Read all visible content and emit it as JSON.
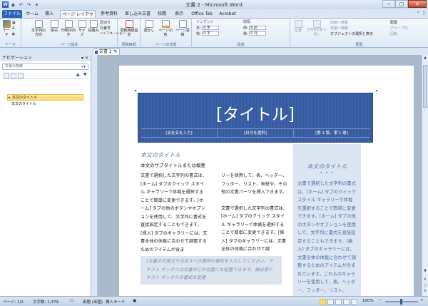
{
  "window": {
    "title": "文書 2 - Microsoft Word",
    "minimize": "─",
    "maximize": "□",
    "close": "✕"
  },
  "tabs": {
    "file": "ファイル",
    "items": [
      "ホーム",
      "挿入",
      "ページ レイアウト",
      "参考資料",
      "差し込み文書",
      "校閲",
      "表示",
      "Office Tab",
      "Acrobat"
    ],
    "active": "ページ レイアウト"
  },
  "ribbon": {
    "theme_group": {
      "label": "テーマ",
      "theme": "テーマ",
      "colors": "配色",
      "fonts": "フォント",
      "effects": "効果"
    },
    "page_setup": {
      "label": "ページ設定",
      "text_direction": "文字列の方向",
      "margins": "余白",
      "orientation": "印刷の向き",
      "size": "サイズ",
      "columns": "段組み",
      "breaks": "区切り",
      "line_numbers": "行番号",
      "hyphenation": "ハイフネーション"
    },
    "manuscript": {
      "label": "原稿用紙",
      "button": "原稿用紙設定"
    },
    "page_background": {
      "label": "ページの背景",
      "watermark": "透かし",
      "page_color": "ページの色",
      "page_borders": "ページ罫線"
    },
    "paragraph": {
      "label": "段落",
      "indent": "インデント",
      "spacing": "間隔",
      "left_label": "左:",
      "left_value": "0 字",
      "right_label": "右:",
      "right_value": "0 字",
      "before_label": "前:",
      "before_value": "6 pt",
      "after_label": "後:",
      "after_value": "0 行"
    },
    "arrange": {
      "label": "配置",
      "position": "位置",
      "wrap": "文字列の折り返し",
      "bring_forward": "前面へ移動",
      "send_backward": "背面へ移動",
      "selection_pane": "オブジェクトの選択と表示",
      "align": "配置",
      "group": "グループ化",
      "rotate": "回転"
    }
  },
  "doc_tab": {
    "label": "文書 2 *",
    "close": "×"
  },
  "nav": {
    "title": "ナビゲーション",
    "search_placeholder": "文書の検索",
    "items": [
      "本文のタイトル",
      "本文のタイトル"
    ]
  },
  "page": {
    "banner_title": "[タイトル]",
    "banner_fields": [
      "[会社名を入力]",
      "[日付を選択]",
      "[第 1 版、第 1 巻]"
    ],
    "main_title": "本文のタイトル",
    "main_sub": "本文のサブタイトルまたは概要",
    "col1": "文書で選択した文字列の書式は、[ホーム] タブのクイック スタイル ギャラリーで体裁を選択することで簡単に変更できます。[ホーム] タブの他のボタンやオプションを使用して、文字列に書式を直接設定することもできます。[挿入] タブのギャラリーには、文書全体の体裁に合わせて調整するためのアイテムが含ま",
    "col2a": "リーを使用して、表、ヘッダー、フッター、リスト、表紙や、その他の文書パーツを挿入できます。",
    "col2b": "文書で選択した文字列の書式は、[ホーム] タブのクイック スタイル ギャラリーで体裁を選択することで簡単に変更できます。[挿入] タブのギャラリーには、文書全体の体裁に合わせて調",
    "quote": "[文書の引用文や注目すべき箇所の要約を入力してください。テキスト ボックスは文書のどの位置にも配置できます。抽出用テキスト ボックスの書式を変更",
    "sidebar_title": "本文のタイトル",
    "sidebar_dots": "• • •",
    "sidebar_body": "文書で選択した文字列の書式は、[ホーム] タブのクイック スタイル ギャラリーで体裁を選択することで簡単に変更できます。[ホーム] タブの他のボタンやオプションを使用して、文字列に書式を直接設定することもできます。[挿入] タブのギャラリーには、文書全体の体裁に合わせて調整するためのアイテムが含まれています。これらのギャラリーを使用して、表、ヘッダー、フッター、リスト、"
  },
  "status": {
    "page": "ページ: 1/2",
    "words": "文字数: 1,379",
    "language": "英語 (米国)",
    "mode": "挿入モード",
    "zoom": "100%",
    "zoom_minus": "−",
    "zoom_plus": "+"
  },
  "colors": {
    "banner": "#3f63a8",
    "sidebar": "#dce6f3",
    "accent": "#2a64b8"
  }
}
